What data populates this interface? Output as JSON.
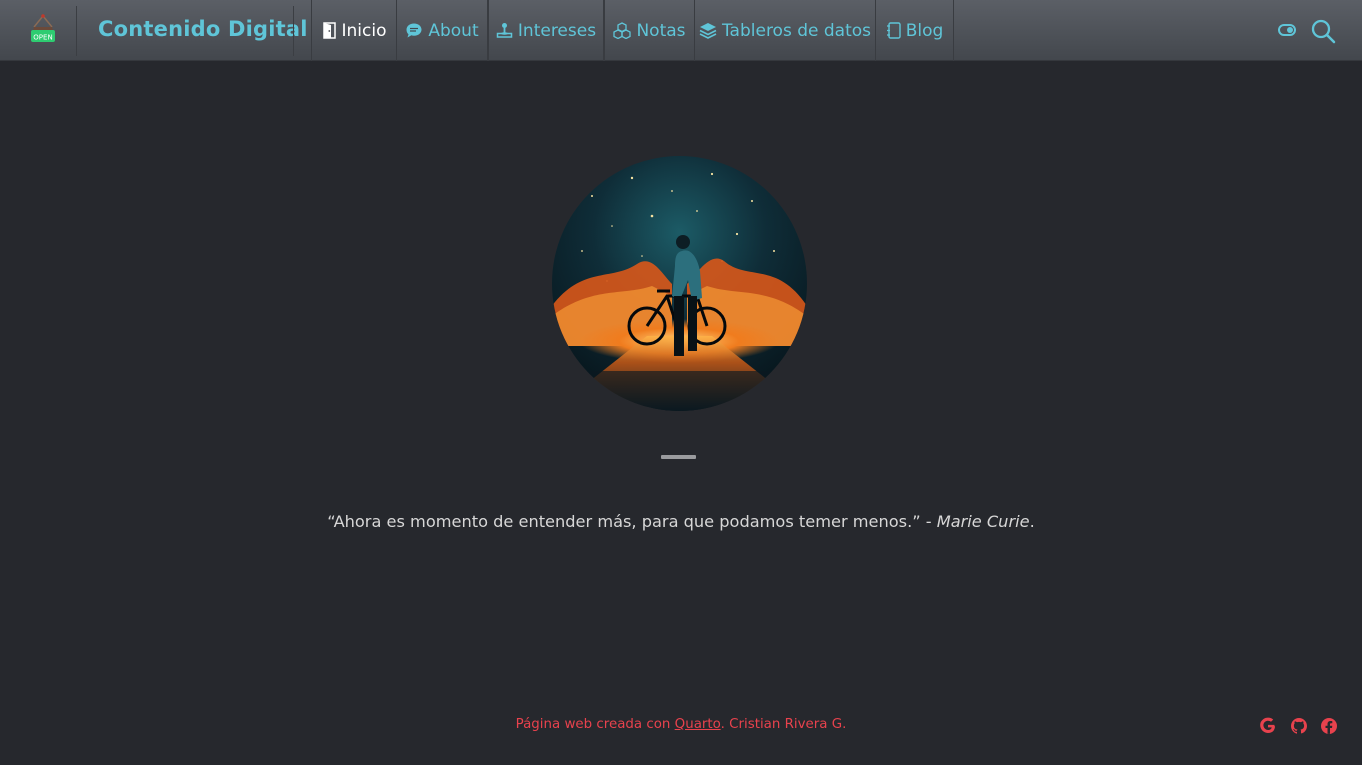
{
  "navbar": {
    "logo_text": "OPEN",
    "brand": "Contenido Digital",
    "items": [
      {
        "label": "Inicio",
        "icon": "door-open-icon",
        "active": true
      },
      {
        "label": "About",
        "icon": "chat-bubble-icon",
        "active": false
      },
      {
        "label": "Intereses",
        "icon": "joystick-icon",
        "active": false
      },
      {
        "label": "Notas",
        "icon": "boxes-icon",
        "active": false
      },
      {
        "label": "Tableros de datos",
        "icon": "layers-icon",
        "active": false
      },
      {
        "label": "Blog",
        "icon": "journal-icon",
        "active": false
      }
    ],
    "accent_color": "#5fc5d8"
  },
  "hero": {
    "image_alt": "avatar-cyclist-under-starry-sky",
    "quote_text": "“Ahora es momento de entender más, para que podamos temer menos.” - ",
    "quote_author": "Marie Curie",
    "quote_end": "."
  },
  "footer": {
    "prefix": "Página web creada con ",
    "link": "Quarto",
    "suffix": ". Cristian Rivera G.",
    "color": "#e8424d",
    "social": [
      "google-icon",
      "github-icon",
      "facebook-icon"
    ]
  }
}
